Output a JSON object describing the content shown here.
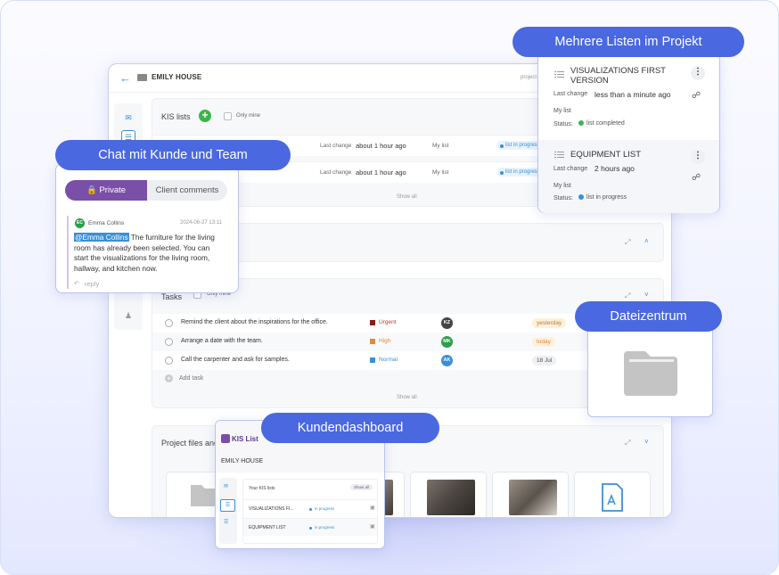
{
  "main": {
    "title": "EMILY HOUSE",
    "project_link": "project",
    "kis": {
      "title": "KIS lists",
      "only_mine": "Only mine",
      "rows": [
        {
          "last_change_label": "Last change",
          "last_change": "about 1 hour ago",
          "owner": "My list",
          "status": "list in progress"
        },
        {
          "last_change_label": "Last change",
          "last_change": "about 1 hour ago",
          "owner": "My list",
          "status": "list in progress"
        }
      ],
      "show_all": "Show all"
    },
    "tasks": {
      "title": "Tasks",
      "only_mine": "Only mine",
      "items": [
        {
          "text": "Remind the client about the inspirations for the office.",
          "priority": "Urgent",
          "assignee": "KZ",
          "due": "yesterday"
        },
        {
          "text": "Arrange a date with the team.",
          "priority": "High",
          "assignee": "MK",
          "due": "today"
        },
        {
          "text": "Call the carpenter and ask for samples.",
          "priority": "Normal",
          "assignee": "AK",
          "due": "18 Jul"
        }
      ],
      "add_task": "Add task",
      "show_all": "Show all"
    },
    "files": {
      "title": "Project files and"
    }
  },
  "chat": {
    "badge": "Chat mit Kunde und Team",
    "tab_private": "Private",
    "tab_client": "Client comments",
    "author_initials": "EC",
    "author": "Emma Collins",
    "timestamp": "2024-06-27 13:11",
    "mention": "@Emma Collins",
    "message": " The furniture for the living room has already been selected. You can start the visualizations for the living room, hallway, and kitchen now.",
    "reply": "reply"
  },
  "lists": {
    "badge": "Mehrere Listen im Projekt",
    "items": [
      {
        "title": "VISUALIZATIONS FIRST VERSION",
        "last_change_label": "Last change",
        "last_change": "less than a minute ago",
        "owner": "My list",
        "status_label": "Status:",
        "status": "list completed",
        "status_color": "#3ab54a"
      },
      {
        "title": "EQUIPMENT LIST",
        "last_change_label": "Last change",
        "last_change": "2 hours ago",
        "owner": "My list",
        "status_label": "Status:",
        "status": "list in progress",
        "status_color": "#3a8fd8"
      }
    ]
  },
  "files_center": {
    "badge": "Dateizentrum"
  },
  "dashboard": {
    "badge": "Kundendashboard",
    "logo": "KIS List",
    "title": "EMILY HOUSE",
    "your_lists": "Your KIS lists",
    "show_all": "Show all",
    "rows": [
      {
        "name": "VISUALIZATIONS FI...",
        "status": "in progress"
      },
      {
        "name": "EQUIPMENT LIST",
        "status": "in progress"
      }
    ]
  },
  "colors": {
    "accent": "#4a68e0",
    "urgent": "#8b1a1a",
    "high": "#e08a3a",
    "normal": "#3a8fd8",
    "private_tab": "#7a4fa8"
  }
}
